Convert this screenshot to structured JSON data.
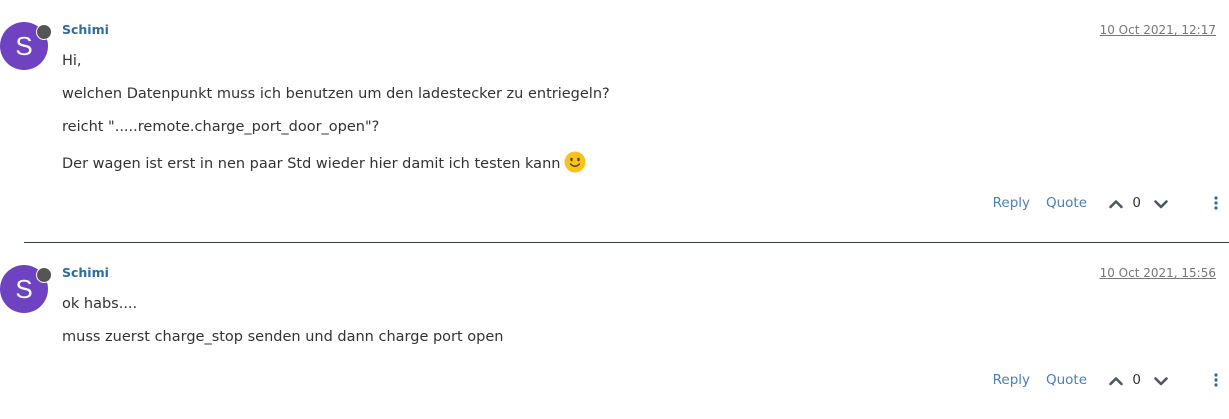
{
  "posts": [
    {
      "avatar_letter": "S",
      "author": "Schimi",
      "timestamp": "10 Oct 2021, 12:17",
      "paragraphs": [
        "Hi,",
        "welchen Datenpunkt muss ich benutzen um den ladestecker zu entriegeln?",
        "reicht \".....remote.charge_port_door_open\"?",
        "Der wagen ist erst in nen paar Std wieder hier damit ich testen kann"
      ],
      "reply_label": "Reply",
      "quote_label": "Quote",
      "votes": "0"
    },
    {
      "avatar_letter": "S",
      "author": "Schimi",
      "timestamp": "10 Oct 2021, 15:56",
      "paragraphs": [
        "ok habs....",
        "muss zuerst charge_stop senden und dann charge port open"
      ],
      "reply_label": "Reply",
      "quote_label": "Quote",
      "votes": "0"
    }
  ],
  "colors": {
    "avatar": "#6f42c1",
    "author": "#2c6ca3",
    "link": "#4a7fb8",
    "status_dot": "#555555"
  },
  "icons": {
    "emoji": "slightly-smiling-face-icon",
    "upvote": "chevron-up-icon",
    "downvote": "chevron-down-icon",
    "menu": "vertical-ellipsis-icon"
  }
}
